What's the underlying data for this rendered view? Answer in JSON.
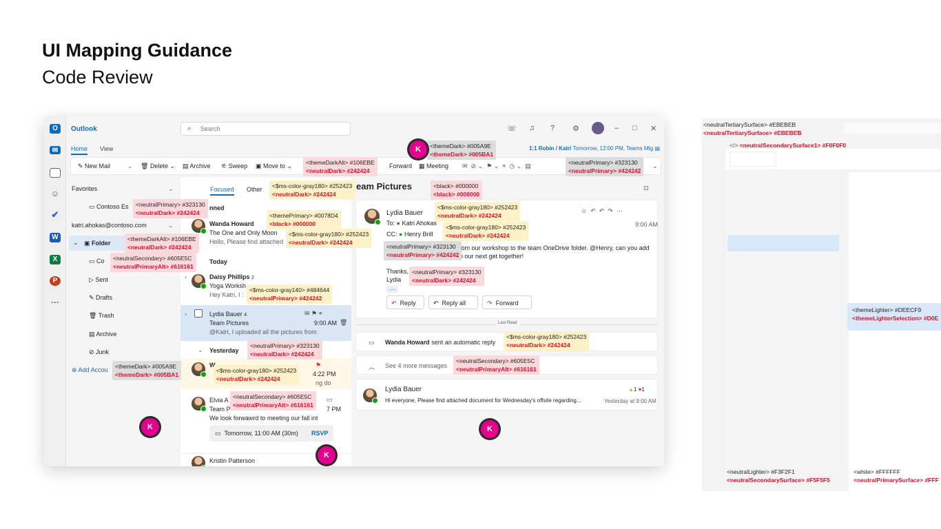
{
  "heading": {
    "title": "UI Mapping Guidance",
    "subtitle": "Code Review"
  },
  "app": {
    "name": "Outlook",
    "search_placeholder": "Search",
    "tabs": [
      "Home",
      "View"
    ],
    "meeting_banner": "1:1 Robin / Katri",
    "meeting_time": "Tomorrow, 12:00 PM, Teams Mtg",
    "ribbon": {
      "new_mail": "New Mail",
      "delete": "Delete",
      "archive": "Archive",
      "sweep": "Sweep",
      "move_to": "Move to",
      "forward": "Forward",
      "meeting": "Meeting"
    }
  },
  "nav": {
    "favorites": "Favorites",
    "contoso": "Contoso Es",
    "account": "katri.ahokas@contoso.com",
    "folder": "Folder",
    "co": "Co",
    "sent": "Sent",
    "drafts": "Drafts",
    "trash": "Trash",
    "archive": "Archive",
    "junk": "Junk",
    "add_account": "Add Accou"
  },
  "list": {
    "focused": "Focused",
    "other": "Other",
    "pinned": "nned",
    "m1": {
      "from": "Wanda Howard",
      "subject": "The One and Only Moon",
      "preview": "Hello, Please find attached"
    },
    "today": "Today",
    "m2": {
      "from": "Daisy Phillips",
      "count": "2",
      "subject": "Yoga Worksh",
      "preview": "Hey Katri, I :"
    },
    "m3": {
      "from": "Lydia Bauer",
      "count": "4",
      "subject": "Team Pictures",
      "time": "9:00 AM",
      "preview": "@Katri, I uploaded all the pictures from"
    },
    "yesterday": "Yesterday",
    "m4": {
      "from": "W",
      "time": "4:22 PM",
      "preview": "ng do"
    },
    "m5": {
      "from": "Elvia A",
      "subject": "Team P",
      "time": "7 PM",
      "preview": "We look forwawrd to meeting our fall int",
      "event": "Tomorrow, 11:00 AM (30m)",
      "rsvp": "RSVP"
    },
    "m6": {
      "from": "Kristin Patterson"
    }
  },
  "reading": {
    "subject": "eam Pictures",
    "from": "Lydia Bauer",
    "to": "To:",
    "to_name": "Katri Ahokas",
    "cc": "CC:",
    "cc_name": "Henry Brill",
    "time": "9:00 AM",
    "body": "s from our workshop to the team OneDrive folder. @Henry, can you add",
    "body2": "n to our next get together!",
    "thanks": "Thanks,",
    "sign": "Lydia",
    "reply": "Reply",
    "reply_all": "Reply all",
    "forward": "Forward",
    "last_read": "Last Read",
    "auto_from": "Wanda Howard",
    "auto_text": "sent an automatic reply",
    "see_more": "See 4 more messages",
    "m2_from": "Lydia Bauer",
    "m2_preview": "Hi everyone, Please find attached document for Wednesday's offsite regarding...",
    "m2_time": "Yesterday at 9:00 AM",
    "reactions": [
      "1",
      "1"
    ]
  },
  "tokens": [
    {
      "a": "<themeDark> #005A9E",
      "b": "<themeDark> #005BA1"
    },
    {
      "a": "<themeDarkAlt> #106EBE",
      "b": "<neutralDark> #242424"
    },
    {
      "a": "<neutralPrimary> #323130",
      "b": "<neutralPrimary> #424242"
    },
    {
      "a": "<$ms-color-gray180> #252423",
      "b": "<neutralDark> #242424"
    },
    {
      "a": "<black> #000000",
      "b": "<black> #000000"
    },
    {
      "a": "<neutralPrimary> #323130",
      "b": "<neutralDark> #242424"
    },
    {
      "a": "<themePrimary> #0078D4",
      "b": "<black> #000000"
    },
    {
      "a": "<$ms-color-gray180> #252423",
      "b": "<neutralDark> #242424"
    },
    {
      "a": "<$ms-color-gray180> #252423",
      "b": "<neutralDark> #242424"
    },
    {
      "a": "<$ms-color-gray180> #252423",
      "b": "<neutralDark> #242424"
    },
    {
      "a": "<themeDarkAlt> #106EBE",
      "b": "<neutralDark> #242424"
    },
    {
      "a": "<neutralPrimary> #323130",
      "b": "<neutralPrimary> #424242"
    },
    {
      "a": "<neutralSecondary> #605E5C",
      "b": "<neutralPrimaryAlt> #616161"
    },
    {
      "a": "<neutralPrimary> #323130",
      "b": "<neutralDark> #242424"
    },
    {
      "a": "<$ms-color-gray140> #484644",
      "b": "<neutralPrimary> #424242"
    },
    {
      "a": "<neutralPrimary> #323130",
      "b": "<neutralDark> #242424"
    },
    {
      "a": "<$ms-color-gray180> #252423",
      "b": "<neutralDark> #242424"
    },
    {
      "a": "<themeDark> #005A9E",
      "b": "<themeDark> #005BA1"
    },
    {
      "a": "<$ms-color-gray180> #252423",
      "b": "<neutralDark> #242424"
    },
    {
      "a": "<neutralSecondary> #605E5C",
      "b": "<neutralPrimaryAlt> #616161"
    },
    {
      "a": "<neutralSecondary> #605E5C",
      "b": "<neutralPrimaryAlt> #616161"
    }
  ],
  "panel": {
    "tertiary_a": "<neutralTertiarySurface> #EBEBEB",
    "tertiary_b": "<neutralTertiarySurface> #EBEBEB",
    "secondary1": "<neutralSecondarySurface1> #F0F0F0",
    "code_icon": "</>",
    "lighter_a": "<themeLighter> #DEECF9",
    "lighter_b": "<themeLighterSelection> #D0E",
    "nl_a": "<neutralLighter> #F3F2F1",
    "nl_b": "<neutralSecondarySurface> #F5F5F5",
    "wh_a": "<white> #FFFFFF",
    "wh_b": "<neutralPrimarySurface> #FFF"
  },
  "marker": "K",
  "colors": {
    "accent": "#0f6cbd",
    "marker": "#e3008c",
    "token_red": "#e0102d"
  }
}
